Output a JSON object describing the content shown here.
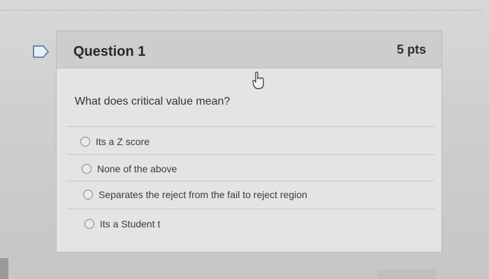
{
  "question": {
    "title": "Question 1",
    "points": "5 pts",
    "prompt": "What does critical value mean?",
    "answers": [
      {
        "label": "Its a Z score"
      },
      {
        "label": "None of the above"
      },
      {
        "label": "Separates the reject from the fail to reject region"
      },
      {
        "label": "Its a Student t"
      }
    ]
  },
  "icons": {
    "flag": "flag-icon",
    "cursor": "hand-pointer-icon"
  },
  "colors": {
    "header_bg": "#cdcdcd",
    "card_bg": "#e4e4e4",
    "text": "#333333"
  }
}
